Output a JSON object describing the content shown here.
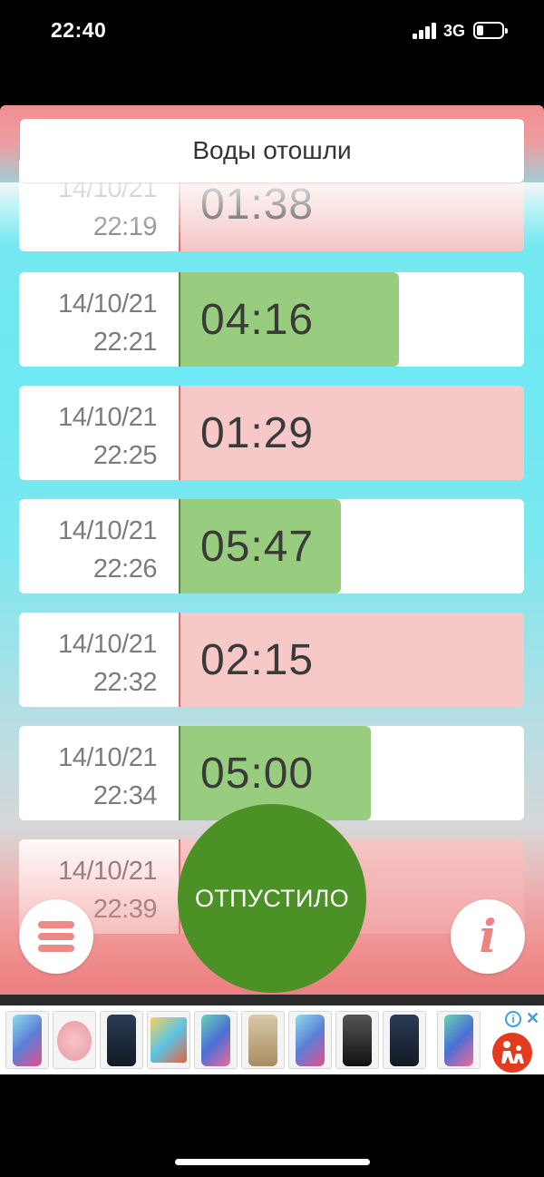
{
  "status_bar": {
    "time": "22:40",
    "network": "3G",
    "icons": [
      "cellular-signal-icon",
      "battery-icon"
    ]
  },
  "header": {
    "title": "Воды отошли"
  },
  "entries": [
    {
      "date": "14/10/21",
      "time": "22:19",
      "duration": "01:38",
      "kind": "short"
    },
    {
      "date": "14/10/21",
      "time": "22:21",
      "duration": "04:16",
      "kind": "long"
    },
    {
      "date": "14/10/21",
      "time": "22:25",
      "duration": "01:29",
      "kind": "short"
    },
    {
      "date": "14/10/21",
      "time": "22:26",
      "duration": "05:47",
      "kind": "long"
    },
    {
      "date": "14/10/21",
      "time": "22:32",
      "duration": "02:15",
      "kind": "short"
    },
    {
      "date": "14/10/21",
      "time": "22:34",
      "duration": "05:00",
      "kind": "long"
    },
    {
      "date": "14/10/21",
      "time": "22:39",
      "duration": "",
      "kind": "short"
    }
  ],
  "controls": {
    "release_label": "ОТПУСТИЛО",
    "menu_icon": "hamburger-menu-icon",
    "info_icon": "i"
  },
  "ad": {
    "info_icon": "i",
    "close_icon": "✕",
    "logo_icon": "ad-brand-logo"
  },
  "colors": {
    "short_bar": "#f6c8c8",
    "long_bar": "#98cd7f",
    "release_button": "#4b9126",
    "accent_pink": "#ec8580"
  }
}
